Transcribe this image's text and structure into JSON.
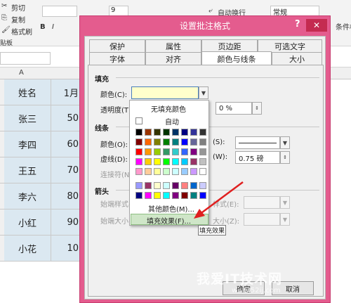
{
  "ribbon": {
    "cut": "剪切",
    "copy": "复制",
    "format_painter": "格式刷",
    "clipboard": "贴板",
    "font_size": "9",
    "wrap_text": "自动换行",
    "number_format": "常规",
    "right_label": "条件格"
  },
  "sheet": {
    "col_a": "A",
    "rows": [
      {
        "name": "姓名",
        "value": "1月"
      },
      {
        "name": "张三",
        "value": "50"
      },
      {
        "name": "李四",
        "value": "60"
      },
      {
        "name": "王五",
        "value": "70"
      },
      {
        "name": "李六",
        "value": "80"
      },
      {
        "name": "小红",
        "value": "90"
      },
      {
        "name": "小花",
        "value": "10"
      }
    ]
  },
  "dialog": {
    "title": "设置批注格式",
    "help": "?",
    "close": "✕",
    "tabs_row1": [
      "保护",
      "属性",
      "页边距",
      "可选文字"
    ],
    "tabs_row2": [
      "字体",
      "对齐",
      "颜色与线条",
      "大小"
    ],
    "selected_tab": "颜色与线条",
    "fill_section": "填充",
    "color_label": "颜色(C):",
    "transparency_label": "透明度(T):",
    "transparency_value": "0 %",
    "line_section": "线条",
    "line_color_label": "颜色(O):",
    "dash_label": "虚线(D):",
    "connector_label": "连接符(N):",
    "style_label": "(S):",
    "weight_label": "(W):",
    "weight_value": "0.75 磅",
    "arrow_section": "箭头",
    "begin_style_label": "始端样式(B)",
    "begin_size_label": "始端大小(I):",
    "end_style_label": "样式(E):",
    "end_size_label": "大小(Z):",
    "ok_label": "确定",
    "cancel_label": "取消"
  },
  "color_menu": {
    "no_fill": "无填充颜色",
    "auto": "自动",
    "more_colors": "其他颜色(M)...",
    "fill_effects": "填充效果(F)...",
    "tooltip": "填充效果"
  },
  "swatches": {
    "row1": [
      "#000000",
      "#993300",
      "#333300",
      "#003300",
      "#003366",
      "#000080",
      "#333399",
      "#333333"
    ],
    "row2": [
      "#800000",
      "#ff6600",
      "#808000",
      "#008000",
      "#008080",
      "#0000ff",
      "#666699",
      "#808080"
    ],
    "row3": [
      "#ff0000",
      "#ff9900",
      "#99cc00",
      "#339966",
      "#33cccc",
      "#3366ff",
      "#800080",
      "#969696"
    ],
    "row4": [
      "#ff00ff",
      "#ffcc00",
      "#ffff00",
      "#00ff00",
      "#00ffff",
      "#00ccff",
      "#993366",
      "#c0c0c0"
    ],
    "row5": [
      "#ff99cc",
      "#ffcc99",
      "#ffff99",
      "#ccffcc",
      "#ccffff",
      "#99ccff",
      "#cc99ff",
      "#ffffff"
    ],
    "row6": [
      "#9999ff",
      "#993366",
      "#ffffcc",
      "#ccffff",
      "#660066",
      "#ff8080",
      "#0066cc",
      "#ccccff"
    ],
    "row7": [
      "#000080",
      "#ff00ff",
      "#ffff00",
      "#00ffff",
      "#800080",
      "#800000",
      "#008080",
      "#0000ff"
    ]
  },
  "watermark": {
    "main": "我爱IT技术网",
    "sub": "www.52ij.com"
  },
  "colors": {
    "dialog_frame": "#e45c8e",
    "selected_fill": "#ffffcc",
    "cell_fill": "#dbe8f1"
  }
}
